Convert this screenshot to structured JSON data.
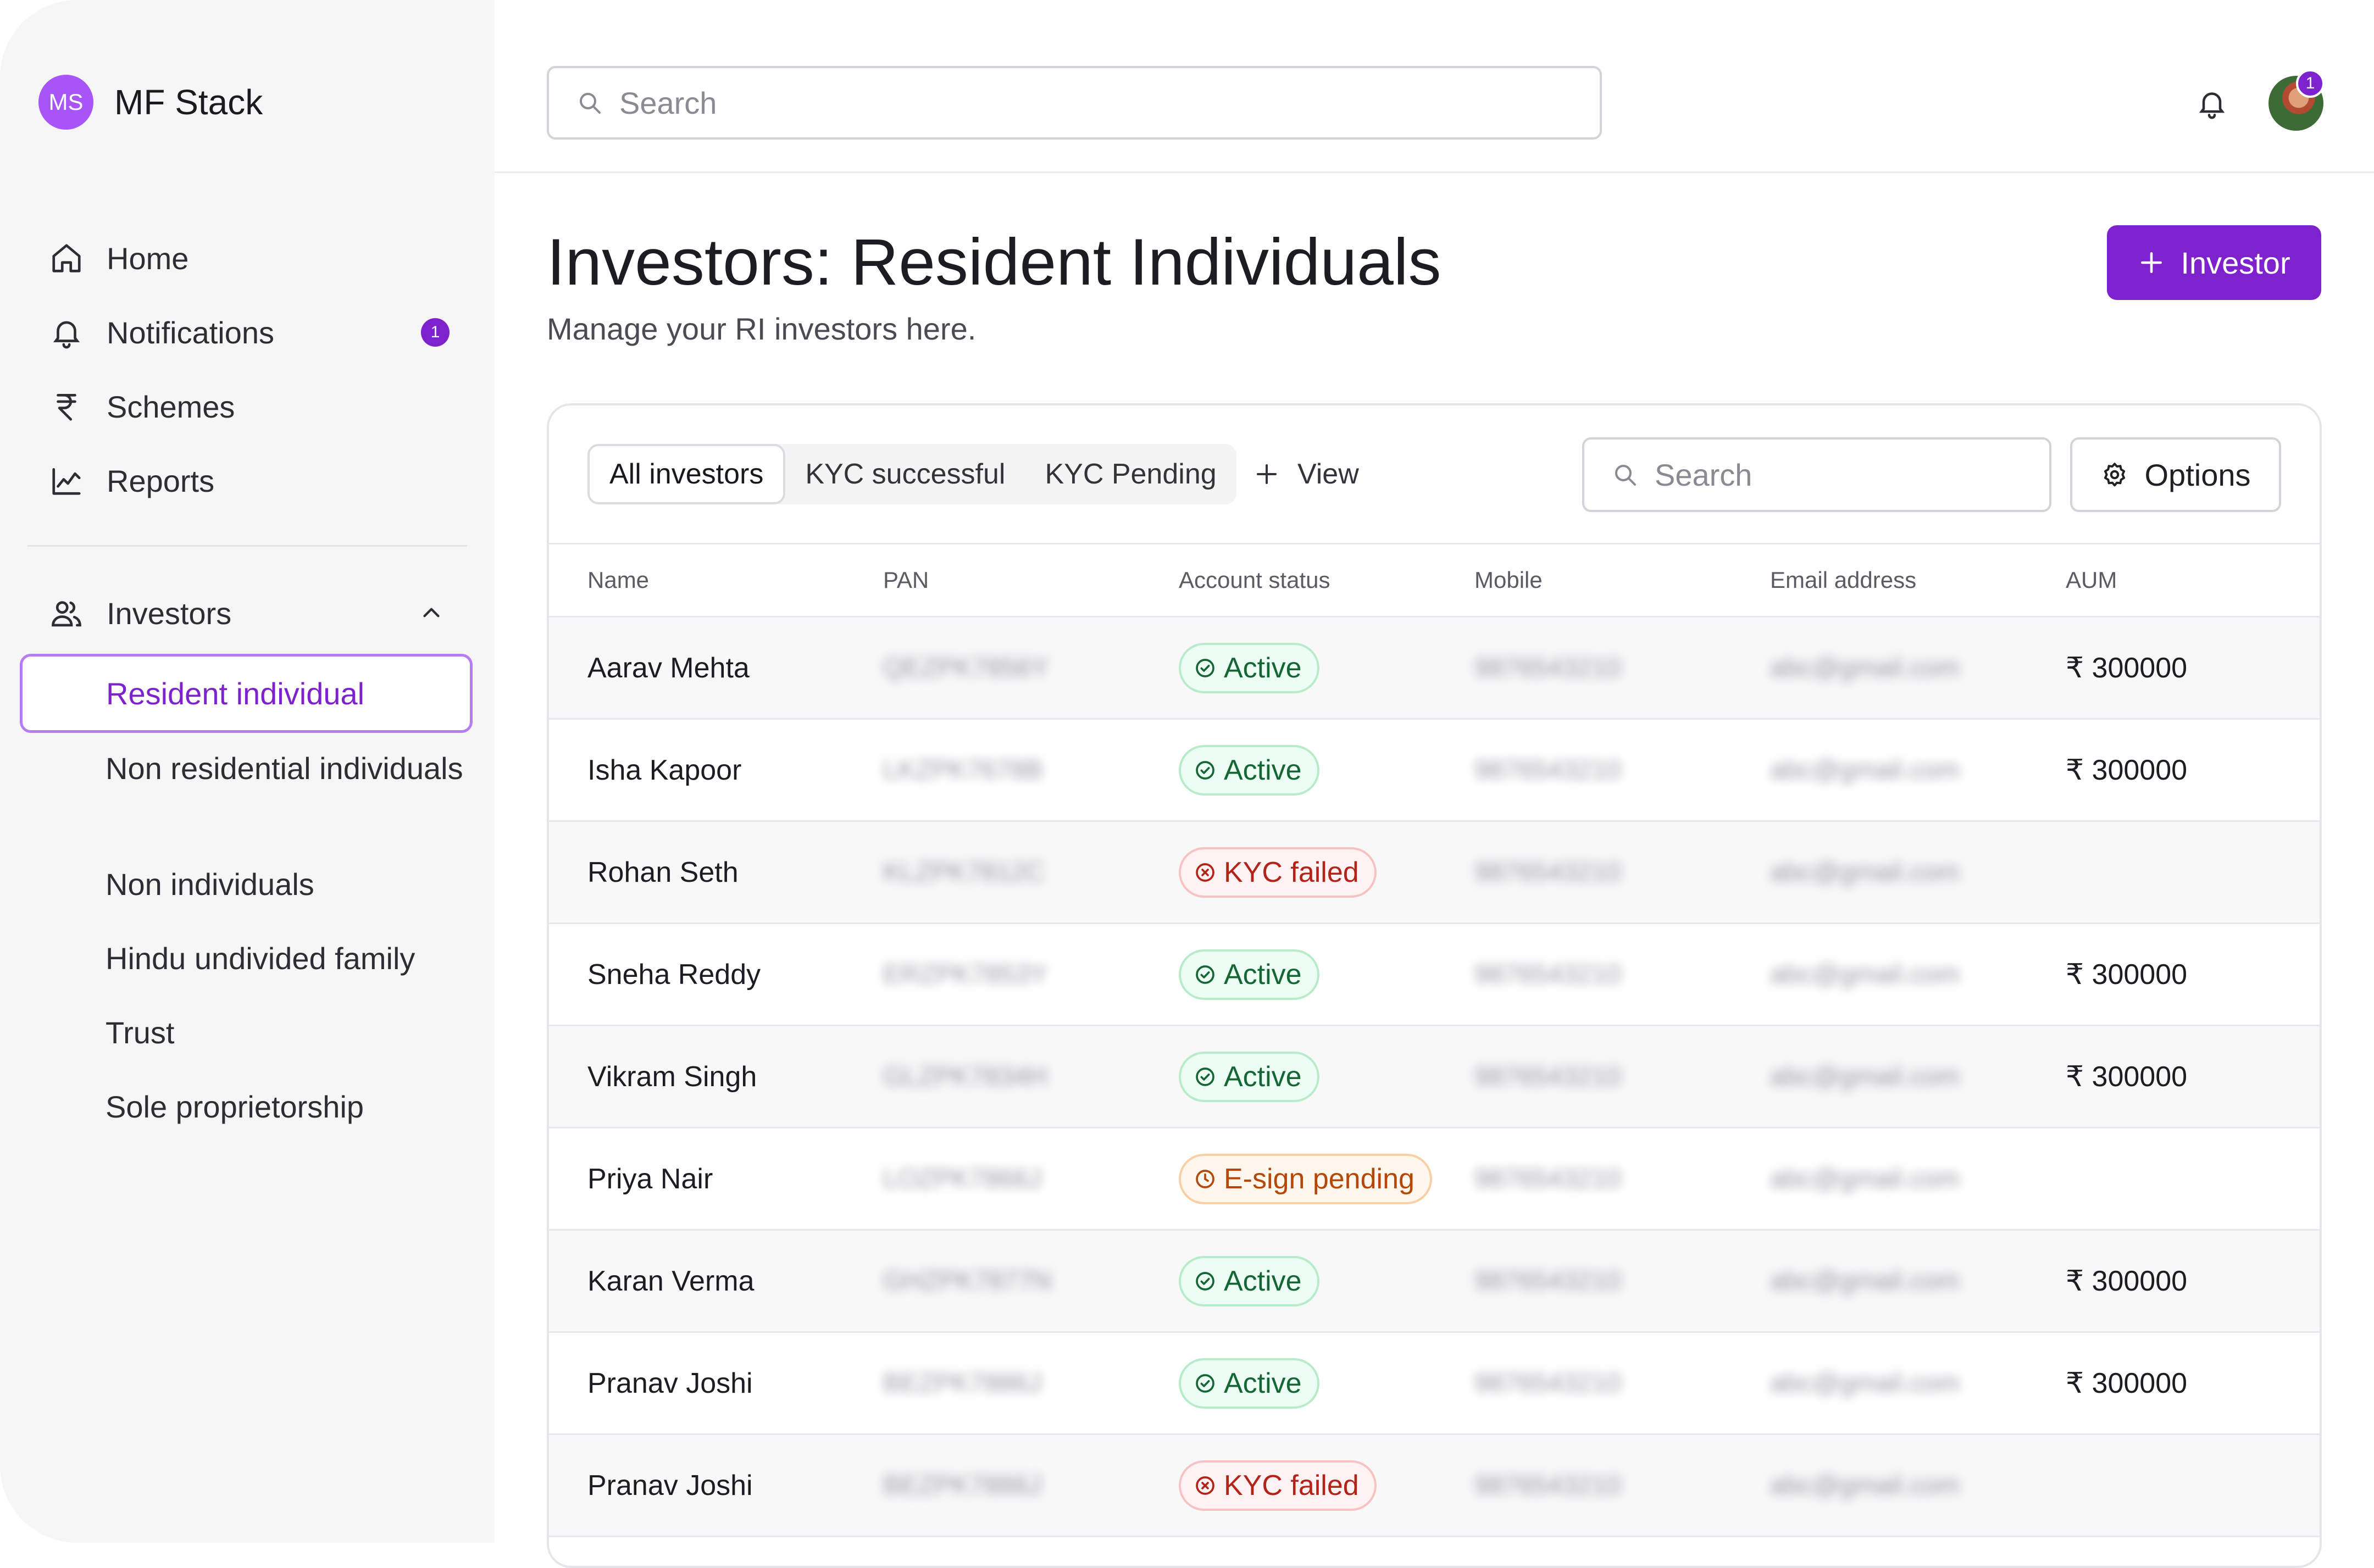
{
  "brand": {
    "initials": "MS",
    "name": "MF Stack"
  },
  "sidebar": {
    "nav": [
      {
        "label": "Home",
        "icon": "home-icon"
      },
      {
        "label": "Notifications",
        "icon": "bell-icon",
        "badge": "1"
      },
      {
        "label": "Schemes",
        "icon": "rupee-icon"
      },
      {
        "label": "Reports",
        "icon": "chart-line-icon"
      }
    ],
    "investors": {
      "label": "Investors",
      "icon": "users-icon",
      "expanded": true,
      "items": [
        "Resident individual",
        "Non residential individuals",
        "Non individuals",
        "Hindu undivided family",
        "Trust",
        "Sole proprietorship"
      ],
      "active": "Resident individual"
    }
  },
  "topbar": {
    "search_placeholder": "Search",
    "avatar_badge": "1"
  },
  "page": {
    "title": "Investors: Resident Individuals",
    "subtitle": "Manage your RI investors here.",
    "add_button": "Investor"
  },
  "toolbar": {
    "tabs": [
      "All investors",
      "KYC successful",
      "KYC Pending"
    ],
    "active_tab": "All investors",
    "view_button": "View",
    "search_placeholder": "Search",
    "options_button": "Options"
  },
  "table": {
    "columns": [
      "Name",
      "PAN",
      "Account status",
      "Mobile",
      "Email address",
      "AUM"
    ],
    "rows": [
      {
        "name": "Aarav Mehta",
        "pan": "QEZPK7856Y",
        "status": "Active",
        "status_type": "ok",
        "mobile": "9876543210",
        "email": "abc@gmail.com",
        "aum": "₹ 300000"
      },
      {
        "name": "Isha Kapoor",
        "pan": "LKZPK7678B",
        "status": "Active",
        "status_type": "ok",
        "mobile": "9876543210",
        "email": "abc@gmail.com",
        "aum": "₹ 300000"
      },
      {
        "name": "Rohan Seth",
        "pan": "KLZPK7812C",
        "status": "KYC failed",
        "status_type": "fail",
        "mobile": "9876543210",
        "email": "abc@gmail.com",
        "aum": ""
      },
      {
        "name": "Sneha Reddy",
        "pan": "ERZPK7853Y",
        "status": "Active",
        "status_type": "ok",
        "mobile": "9876543210",
        "email": "abc@gmail.com",
        "aum": "₹ 300000"
      },
      {
        "name": "Vikram Singh",
        "pan": "GLZPK7834H",
        "status": "Active",
        "status_type": "ok",
        "mobile": "9876543210",
        "email": "abc@gmail.com",
        "aum": "₹ 300000"
      },
      {
        "name": "Priya Nair",
        "pan": "LOZPK7866J",
        "status": "E-sign pending",
        "status_type": "warn",
        "mobile": "9876543210",
        "email": "abc@gmail.com",
        "aum": ""
      },
      {
        "name": "Karan Verma",
        "pan": "GHZPK7877N",
        "status": "Active",
        "status_type": "ok",
        "mobile": "9876543210",
        "email": "abc@gmail.com",
        "aum": "₹ 300000"
      },
      {
        "name": "Pranav Joshi",
        "pan": "BEZPK7886J",
        "status": "Active",
        "status_type": "ok",
        "mobile": "9876543210",
        "email": "abc@gmail.com",
        "aum": "₹ 300000"
      },
      {
        "name": "Pranav Joshi",
        "pan": "BEZPK7886J",
        "status": "KYC failed",
        "status_type": "fail",
        "mobile": "9876543210",
        "email": "abc@gmail.com",
        "aum": ""
      }
    ]
  },
  "colors": {
    "accent": "#7e22ce",
    "brand_badge": "#a855f7",
    "ok": "#166534",
    "fail": "#b42318",
    "warn": "#b54708"
  }
}
